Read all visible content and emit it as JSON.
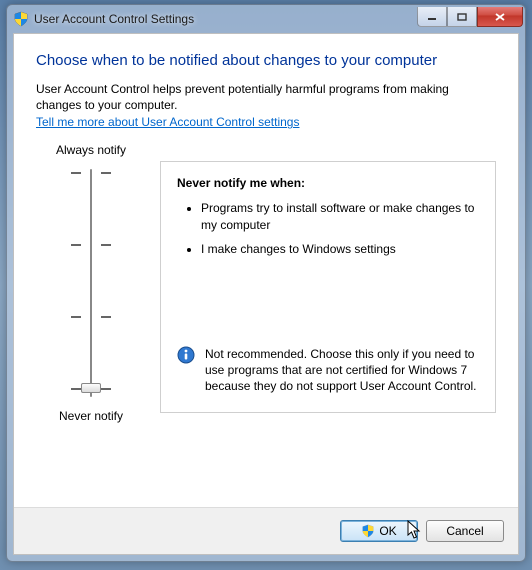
{
  "window": {
    "title": "User Account Control Settings"
  },
  "content": {
    "heading": "Choose when to be notified about changes to your computer",
    "intro": "User Account Control helps prevent potentially harmful programs from making changes to your computer.",
    "learn_more": "Tell me more about User Account Control settings"
  },
  "slider": {
    "top_label": "Always notify",
    "bottom_label": "Never notify"
  },
  "details": {
    "heading": "Never notify me when:",
    "bullets": [
      "Programs try to install software or make changes to my computer",
      "I make changes to Windows settings"
    ],
    "info": "Not recommended. Choose this only if you need to use programs that are not certified for Windows 7 because they do not support User Account Control."
  },
  "footer": {
    "ok": "OK",
    "cancel": "Cancel"
  }
}
